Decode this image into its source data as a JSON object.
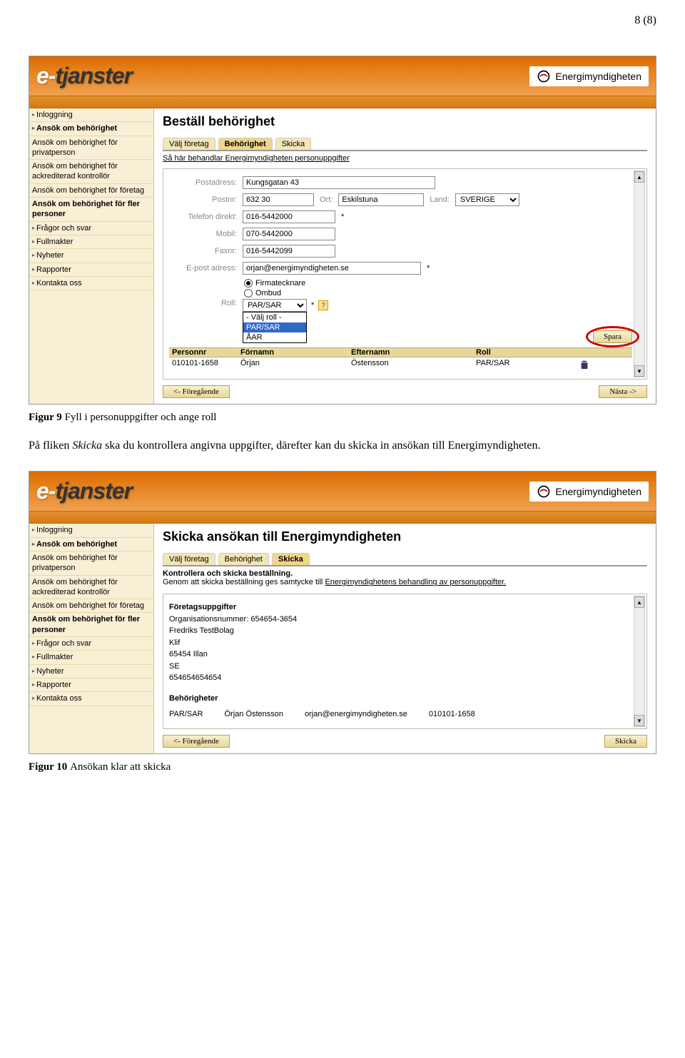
{
  "pageNumber": "8 (8)",
  "branding": {
    "logoPrefix": "e-",
    "logoSuffix": "tjanster",
    "agency": "Energimyndigheten"
  },
  "sidebar": {
    "items": [
      {
        "label": "Inloggning",
        "arrow": true
      },
      {
        "label": "Ansök om behörighet",
        "arrow": true,
        "bold": true
      },
      {
        "label": "Ansök om behörighet för privatperson"
      },
      {
        "label": "Ansök om behörighet för ackrediterad kontrollör"
      },
      {
        "label": "Ansök om behörighet för företag"
      },
      {
        "label": "Ansök om behörighet för fler personer",
        "bold": true
      },
      {
        "label": "Frågor och svar",
        "arrow": true
      },
      {
        "label": "Fullmakter",
        "arrow": true
      },
      {
        "label": "Nyheter",
        "arrow": true
      },
      {
        "label": "Rapporter",
        "arrow": true
      },
      {
        "label": "Kontakta oss",
        "arrow": true
      }
    ]
  },
  "screenshot1": {
    "title": "Beställ behörighet",
    "tabs": [
      "Välj företag",
      "Behörighet",
      "Skicka"
    ],
    "activeTab": "Behörighet",
    "privacyLink": "Så här behandlar Energimyndigheten personuppgifter",
    "fields": {
      "postadressLabel": "Postadress:",
      "postadress": "Kungsgatan 43",
      "postnrLabel": "Postnr:",
      "postnr": "632 30",
      "ortLabel": "Ort:",
      "ort": "Eskilstuna",
      "landLabel": "Land:",
      "land": "SVERIGE",
      "telefonLabel": "Telefon direkt:",
      "telefon": "016-5442000",
      "mobilLabel": "Mobil:",
      "mobil": "070-5442000",
      "faxLabel": "Faxnr:",
      "fax": "016-5442099",
      "epostLabel": "E-post adress:",
      "epost": "orjan@energimyndigheten.se",
      "radio1": "Firmatecknare",
      "radio2": "Ombud",
      "rollLabel": "Roll:",
      "roll": "PAR/SAR",
      "rollOptions": [
        "- Välj roll -",
        "PAR/SAR",
        "ÅAR"
      ],
      "asterisk": "*"
    },
    "sparaBtn": "Spara",
    "tableHeaders": {
      "a": "Personnr",
      "b": "Förnamn",
      "c": "Efternamn",
      "d": "Roll"
    },
    "tableRow": {
      "a": "010101-1658",
      "b": "Örjan",
      "c": "Östensson",
      "d": "PAR/SAR"
    },
    "prevBtn": "<- Föregående",
    "nextBtn": "Nästa ->"
  },
  "caption1": {
    "prefix": "Figur 9 ",
    "text": "Fyll i personuppgifter och ange roll"
  },
  "bodyText": {
    "pre": "På fliken ",
    "italic": "Skicka",
    "post": " ska du kontrollera angivna uppgifter, därefter kan du skicka in ansökan till Energimyndigheten."
  },
  "screenshot2": {
    "title": "Skicka ansökan till Energimyndigheten",
    "tabs": [
      "Välj företag",
      "Behörighet",
      "Skicka"
    ],
    "activeTab": "Skicka",
    "confirmHeading": "Kontrollera och skicka beställning.",
    "confirmText1": "Genom att skicka beställning ges samtycke till ",
    "confirmLink": "Energimyndighetens behandling av personuppgifter.",
    "companyHeading": "Företagsuppgifter",
    "orgnr": "Organisationsnummer: 654654-3654",
    "company": "Fredriks TestBolag",
    "klif": "Klif",
    "cityline": "65454 Illan",
    "country": "SE",
    "phone": "654654654654",
    "permHeading": "Behörigheter",
    "permRow": {
      "role": "PAR/SAR",
      "name": "Örjan Östensson",
      "email": "orjan@energimyndigheten.se",
      "pnr": "010101-1658"
    },
    "prevBtn": "<- Föregående",
    "sendBtn": "Skicka"
  },
  "caption2": {
    "prefix": "Figur 10 ",
    "text": "Ansökan klar att skicka"
  }
}
